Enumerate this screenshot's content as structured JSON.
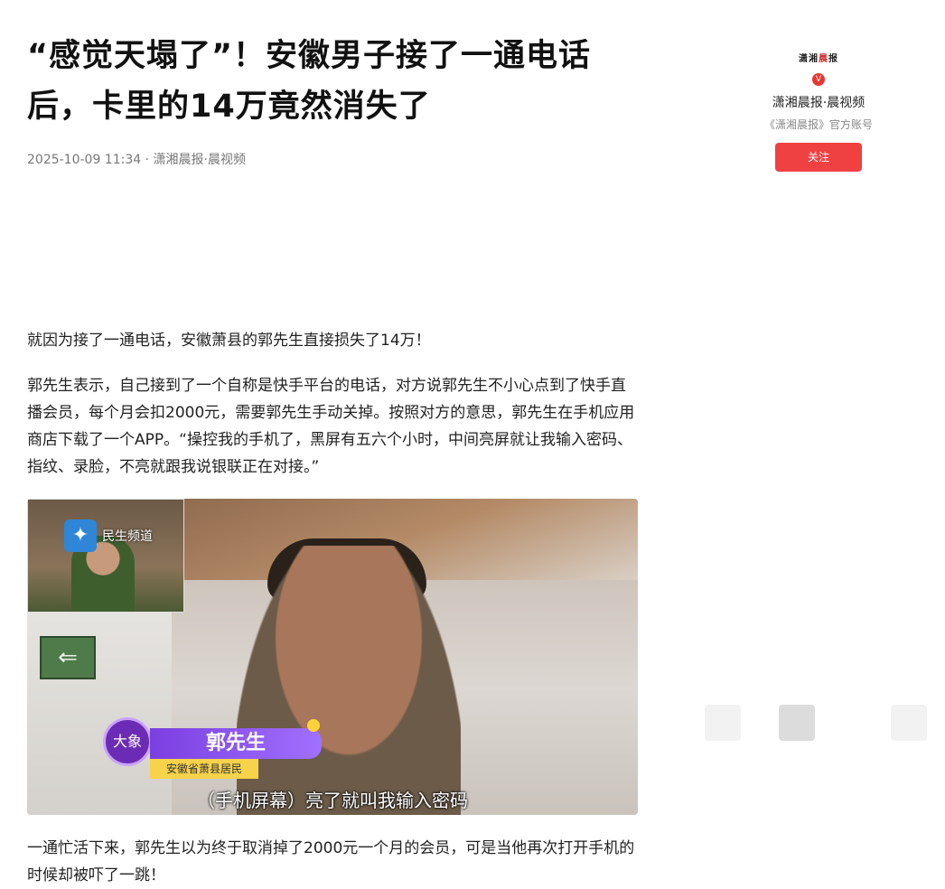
{
  "article": {
    "title_line1": "“感觉天塌了”！安徽男子接了一通电话",
    "title_line2": "后，卡里的14万竟然消失了",
    "meta": "2025-10-09 11:34 · 潇湘晨报·晨视频",
    "p1": "就因为接了一通电话，安徽萧县的郭先生直接损失了14万！",
    "p2": "郭先生表示，自己接到了一个自称是快手平台的电话，对方说郭先生不小心点到了快手直播会员，每个月会扣2000元，需要郭先生手动关掉。按照对方的意思，郭先生在手机应用商店下载了一个APP。“操控我的手机了，黑屏有五六个小时，中间亮屏就让我输入密码、指纹、录脸，不亮就跟我说银联正在对接。”",
    "p3": "一通忙活下来，郭先生以为终于取消掉了2000元一个月的会员，可是当他再次打开手机的时候却被吓了一跳！"
  },
  "video": {
    "pip_brand": "民生频道",
    "name": "郭先生",
    "subtitle": "安徽省萧县居民",
    "caption": "（手机屏幕）亮了就叫我输入密码",
    "badge": "大象"
  },
  "sidebar": {
    "logo_a": "潇湘",
    "logo_b": "晨",
    "logo_c": "报",
    "v": "V",
    "account_name": "潇湘晨报·晨视频",
    "account_desc": "《潇湘晨报》官方账号",
    "follow": "关注"
  }
}
